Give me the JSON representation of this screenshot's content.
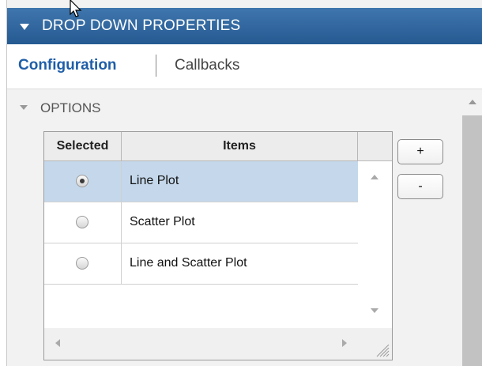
{
  "header": {
    "title": "DROP DOWN PROPERTIES"
  },
  "tabs": [
    {
      "label": "Configuration",
      "active": true
    },
    {
      "label": "Callbacks",
      "active": false
    }
  ],
  "section": {
    "label": "OPTIONS"
  },
  "table": {
    "columns": [
      "Selected",
      "Items",
      ""
    ],
    "rows": [
      {
        "selected": true,
        "item": "Line Plot"
      },
      {
        "selected": false,
        "item": "Scatter Plot"
      },
      {
        "selected": false,
        "item": "Line and Scatter Plot"
      }
    ]
  },
  "buttons": {
    "add_label": "+",
    "remove_label": "-"
  },
  "colors": {
    "titlebar": "#2b5f96",
    "active_tab": "#1f5ea8",
    "selected_row": "#c5d8eb"
  }
}
